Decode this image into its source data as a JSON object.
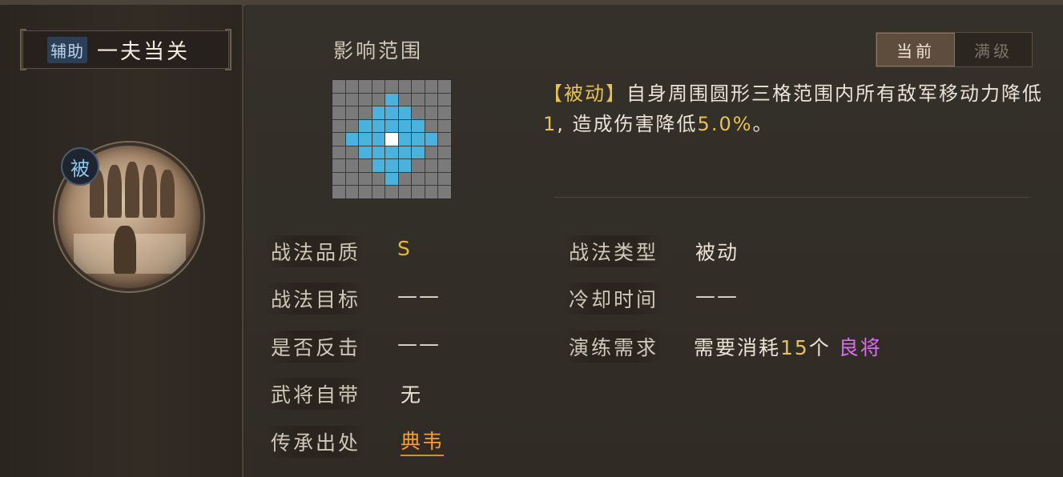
{
  "header": {
    "tag": "辅助",
    "skill_name": "一夫当关"
  },
  "portrait": {
    "badge": "被"
  },
  "range": {
    "title": "影响范围",
    "grid_size": 9,
    "cells_on": [
      [
        2,
        4
      ],
      [
        3,
        3
      ],
      [
        3,
        4
      ],
      [
        3,
        5
      ],
      [
        4,
        2
      ],
      [
        4,
        3
      ],
      [
        4,
        5
      ],
      [
        4,
        6
      ],
      [
        5,
        3
      ],
      [
        5,
        4
      ],
      [
        5,
        5
      ],
      [
        6,
        4
      ],
      [
        1,
        4
      ],
      [
        4,
        1
      ],
      [
        4,
        7
      ],
      [
        7,
        4
      ],
      [
        2,
        3
      ],
      [
        2,
        5
      ],
      [
        3,
        2
      ],
      [
        3,
        6
      ],
      [
        5,
        2
      ],
      [
        5,
        6
      ],
      [
        6,
        3
      ],
      [
        6,
        5
      ]
    ],
    "center": [
      4,
      4
    ],
    "colors": {
      "cell": "#7a7a7a",
      "on": "#4ab3dd",
      "center": "#ffffff"
    }
  },
  "toggle": {
    "current": "当前",
    "max": "满级"
  },
  "description": {
    "kw": "【被动】",
    "part1": "自身周围圆形三格范围内所有敌军移动力降低",
    "num1": "1",
    "part2": ", 造成伤害降低",
    "num2": "5.0%",
    "part3": "。"
  },
  "details": {
    "quality_label": "战法品质",
    "quality_value": "S",
    "target_label": "战法目标",
    "target_value": "——",
    "counter_label": "是否反击",
    "counter_value": "——",
    "own_label": "武将自带",
    "own_value": "无",
    "source_label": "传承出处",
    "source_value": "典韦",
    "type_label": "战法类型",
    "type_value": "被动",
    "cooldown_label": "冷却时间",
    "cooldown_value": "——",
    "drill_label": "演练需求",
    "drill_pre": "需要消耗",
    "drill_num": "15",
    "drill_unit": "个",
    "drill_item": "良将"
  }
}
